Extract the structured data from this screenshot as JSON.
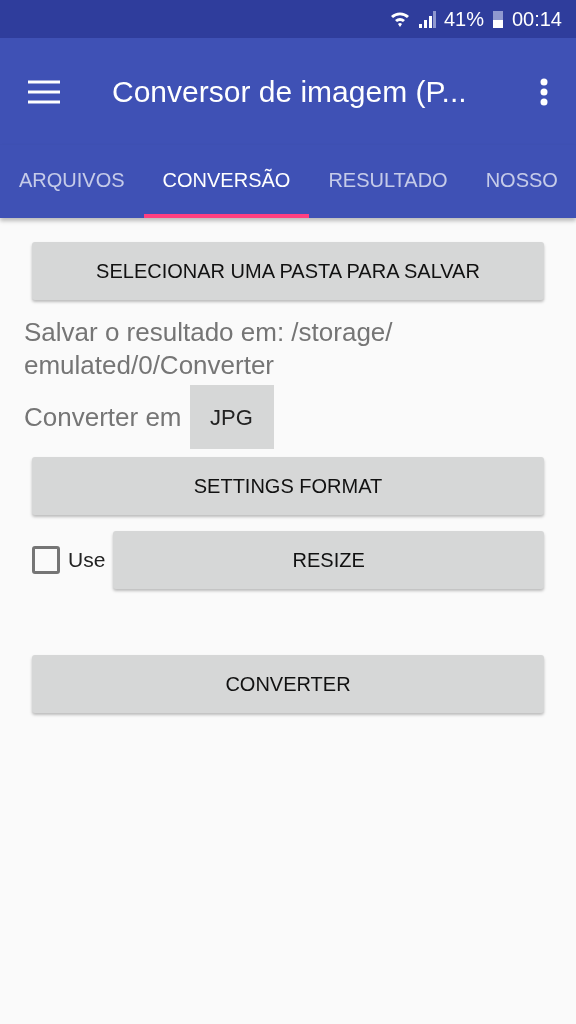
{
  "status_bar": {
    "battery": "41%",
    "time": "00:14"
  },
  "app_bar": {
    "title": "Conversor de imagem (P..."
  },
  "tabs": [
    {
      "label": "ARQUIVOS",
      "selected": false
    },
    {
      "label": "CONVERSÃO",
      "selected": true
    },
    {
      "label": "RESULTADO",
      "selected": false
    },
    {
      "label": "NOSSO",
      "selected": false
    }
  ],
  "select_folder_button": "SELECIONAR UMA PASTA PARA SALVAR",
  "save_path": "Salvar o resultado em: /storage/ emulated/0/Converter",
  "convert_to": {
    "label": "Converter em",
    "value": "JPG"
  },
  "settings_button": "SETTINGS FORMAT",
  "resize": {
    "checkbox_label": "Use",
    "checked": false,
    "button": "RESIZE"
  },
  "convert_button": "CONVERTER"
}
